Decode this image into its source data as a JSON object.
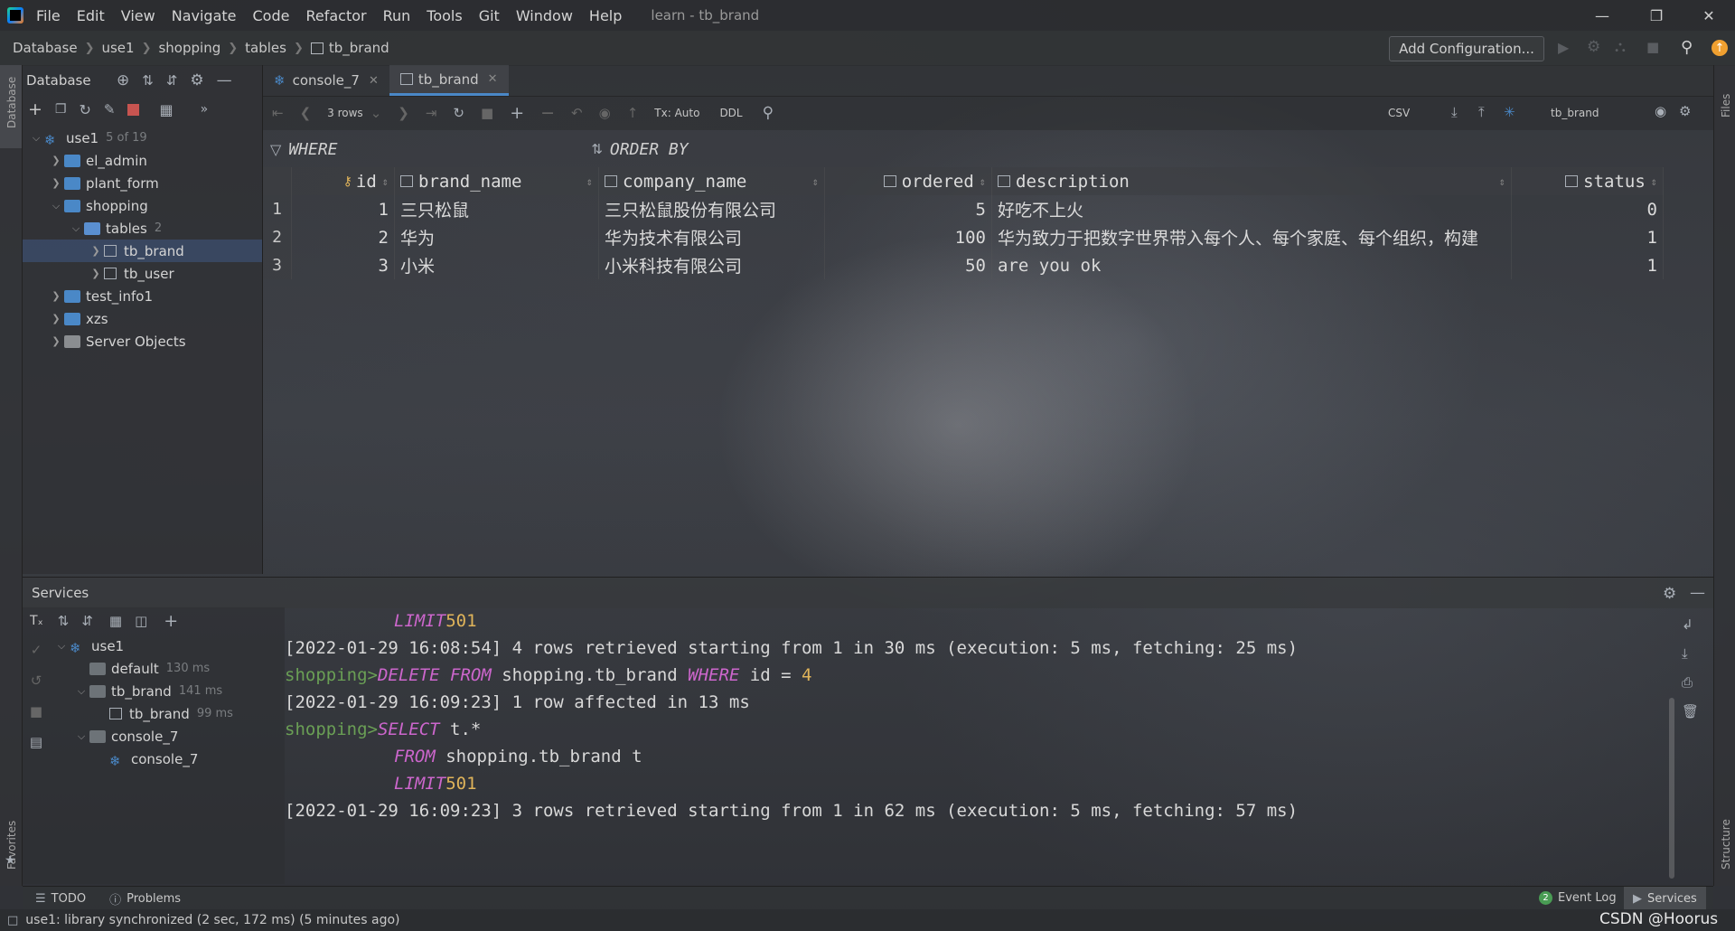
{
  "titlebar": {
    "menu": [
      "File",
      "Edit",
      "View",
      "Navigate",
      "Code",
      "Refactor",
      "Run",
      "Tools",
      "Git",
      "Window",
      "Help"
    ],
    "title": "learn - tb_brand"
  },
  "breadcrumb": [
    "Database",
    "use1",
    "shopping",
    "tables",
    "tb_brand"
  ],
  "toolbar": {
    "add_configuration": "Add Configuration..."
  },
  "sidestrips": {
    "left_top": "Database",
    "left_bottom": "Favorites",
    "right_top": "Files",
    "right_bottom": "Structure"
  },
  "db_panel": {
    "title": "Database",
    "tree": {
      "root": {
        "label": "use1",
        "count": "5 of 19"
      },
      "el_admin": "el_admin",
      "plant_form": "plant_form",
      "shopping": "shopping",
      "tables": {
        "label": "tables",
        "count": "2"
      },
      "tb_brand": "tb_brand",
      "tb_user": "tb_user",
      "test_info1": "test_info1",
      "xzs": "xzs",
      "server_objects": "Server Objects"
    }
  },
  "tabs": [
    {
      "label": "console_7"
    },
    {
      "label": "tb_brand",
      "active": true
    }
  ],
  "grid_toolbar": {
    "rows": "3 rows",
    "tx": "Tx: Auto",
    "ddl": "DDL",
    "export_format": "CSV",
    "datasource": "tb_brand"
  },
  "filter": {
    "where": "WHERE",
    "order_by": "ORDER BY"
  },
  "grid": {
    "columns": [
      "id",
      "brand_name",
      "company_name",
      "ordered",
      "description",
      "status"
    ],
    "rows": [
      {
        "n": "1",
        "id": "1",
        "brand_name": "三只松鼠",
        "company_name": "三只松鼠股份有限公司",
        "ordered": "5",
        "description": "好吃不上火",
        "status": "0"
      },
      {
        "n": "2",
        "id": "2",
        "brand_name": "华为",
        "company_name": "华为技术有限公司",
        "ordered": "100",
        "description": "华为致力于把数字世界带入每个人、每个家庭、每个组织，构建",
        "status": "1"
      },
      {
        "n": "3",
        "id": "3",
        "brand_name": "小米",
        "company_name": "小米科技有限公司",
        "ordered": "50",
        "description": "are you ok",
        "status": "1"
      }
    ]
  },
  "services": {
    "title": "Services",
    "tree": {
      "use1": "use1",
      "default": {
        "label": "default",
        "time": "130 ms"
      },
      "tb_brand": {
        "label": "tb_brand",
        "time": "141 ms"
      },
      "tb_brand_child": {
        "label": "tb_brand",
        "time": "99 ms"
      },
      "console_7": "console_7",
      "console_7_child": "console_7"
    },
    "console": {
      "l1": {
        "kw": "LIMIT",
        "num": "501"
      },
      "l2": "[2022-01-29 16:08:54] 4 rows retrieved starting from 1 in 30 ms (execution: 5 ms, fetching: 25 ms)",
      "l3": {
        "prompt": "shopping>",
        "kw1": "DELETE FROM",
        "t1": " shopping.tb_brand ",
        "kw2": "WHERE",
        "t2": " id = ",
        "num": "4"
      },
      "l4": "[2022-01-29 16:09:23] 1 row affected in 13 ms",
      "l5": {
        "prompt": "shopping>",
        "kw": "SELECT",
        "t": " t.*"
      },
      "l6": {
        "kw": "FROM",
        "t": " shopping.tb_brand t"
      },
      "l7": {
        "kw": "LIMIT",
        "num": "501"
      },
      "l8": "[2022-01-29 16:09:23] 3 rows retrieved starting from 1 in 62 ms (execution: 5 ms, fetching: 57 ms)"
    }
  },
  "bottom_tools": {
    "todo": "TODO",
    "problems": "Problems",
    "event_log_count": "2",
    "event_log": "Event Log",
    "services": "Services"
  },
  "statusbar": {
    "message": "use1: library synchronized (2 sec, 172 ms) (5 minutes ago)",
    "watermark": "CSDN @Hoorus"
  },
  "colors": {
    "accent": "#4a88c7",
    "prompt": "#6a9f55",
    "keyword": "#cc66cc",
    "number": "#e0b45a",
    "stop": "#c75450"
  }
}
